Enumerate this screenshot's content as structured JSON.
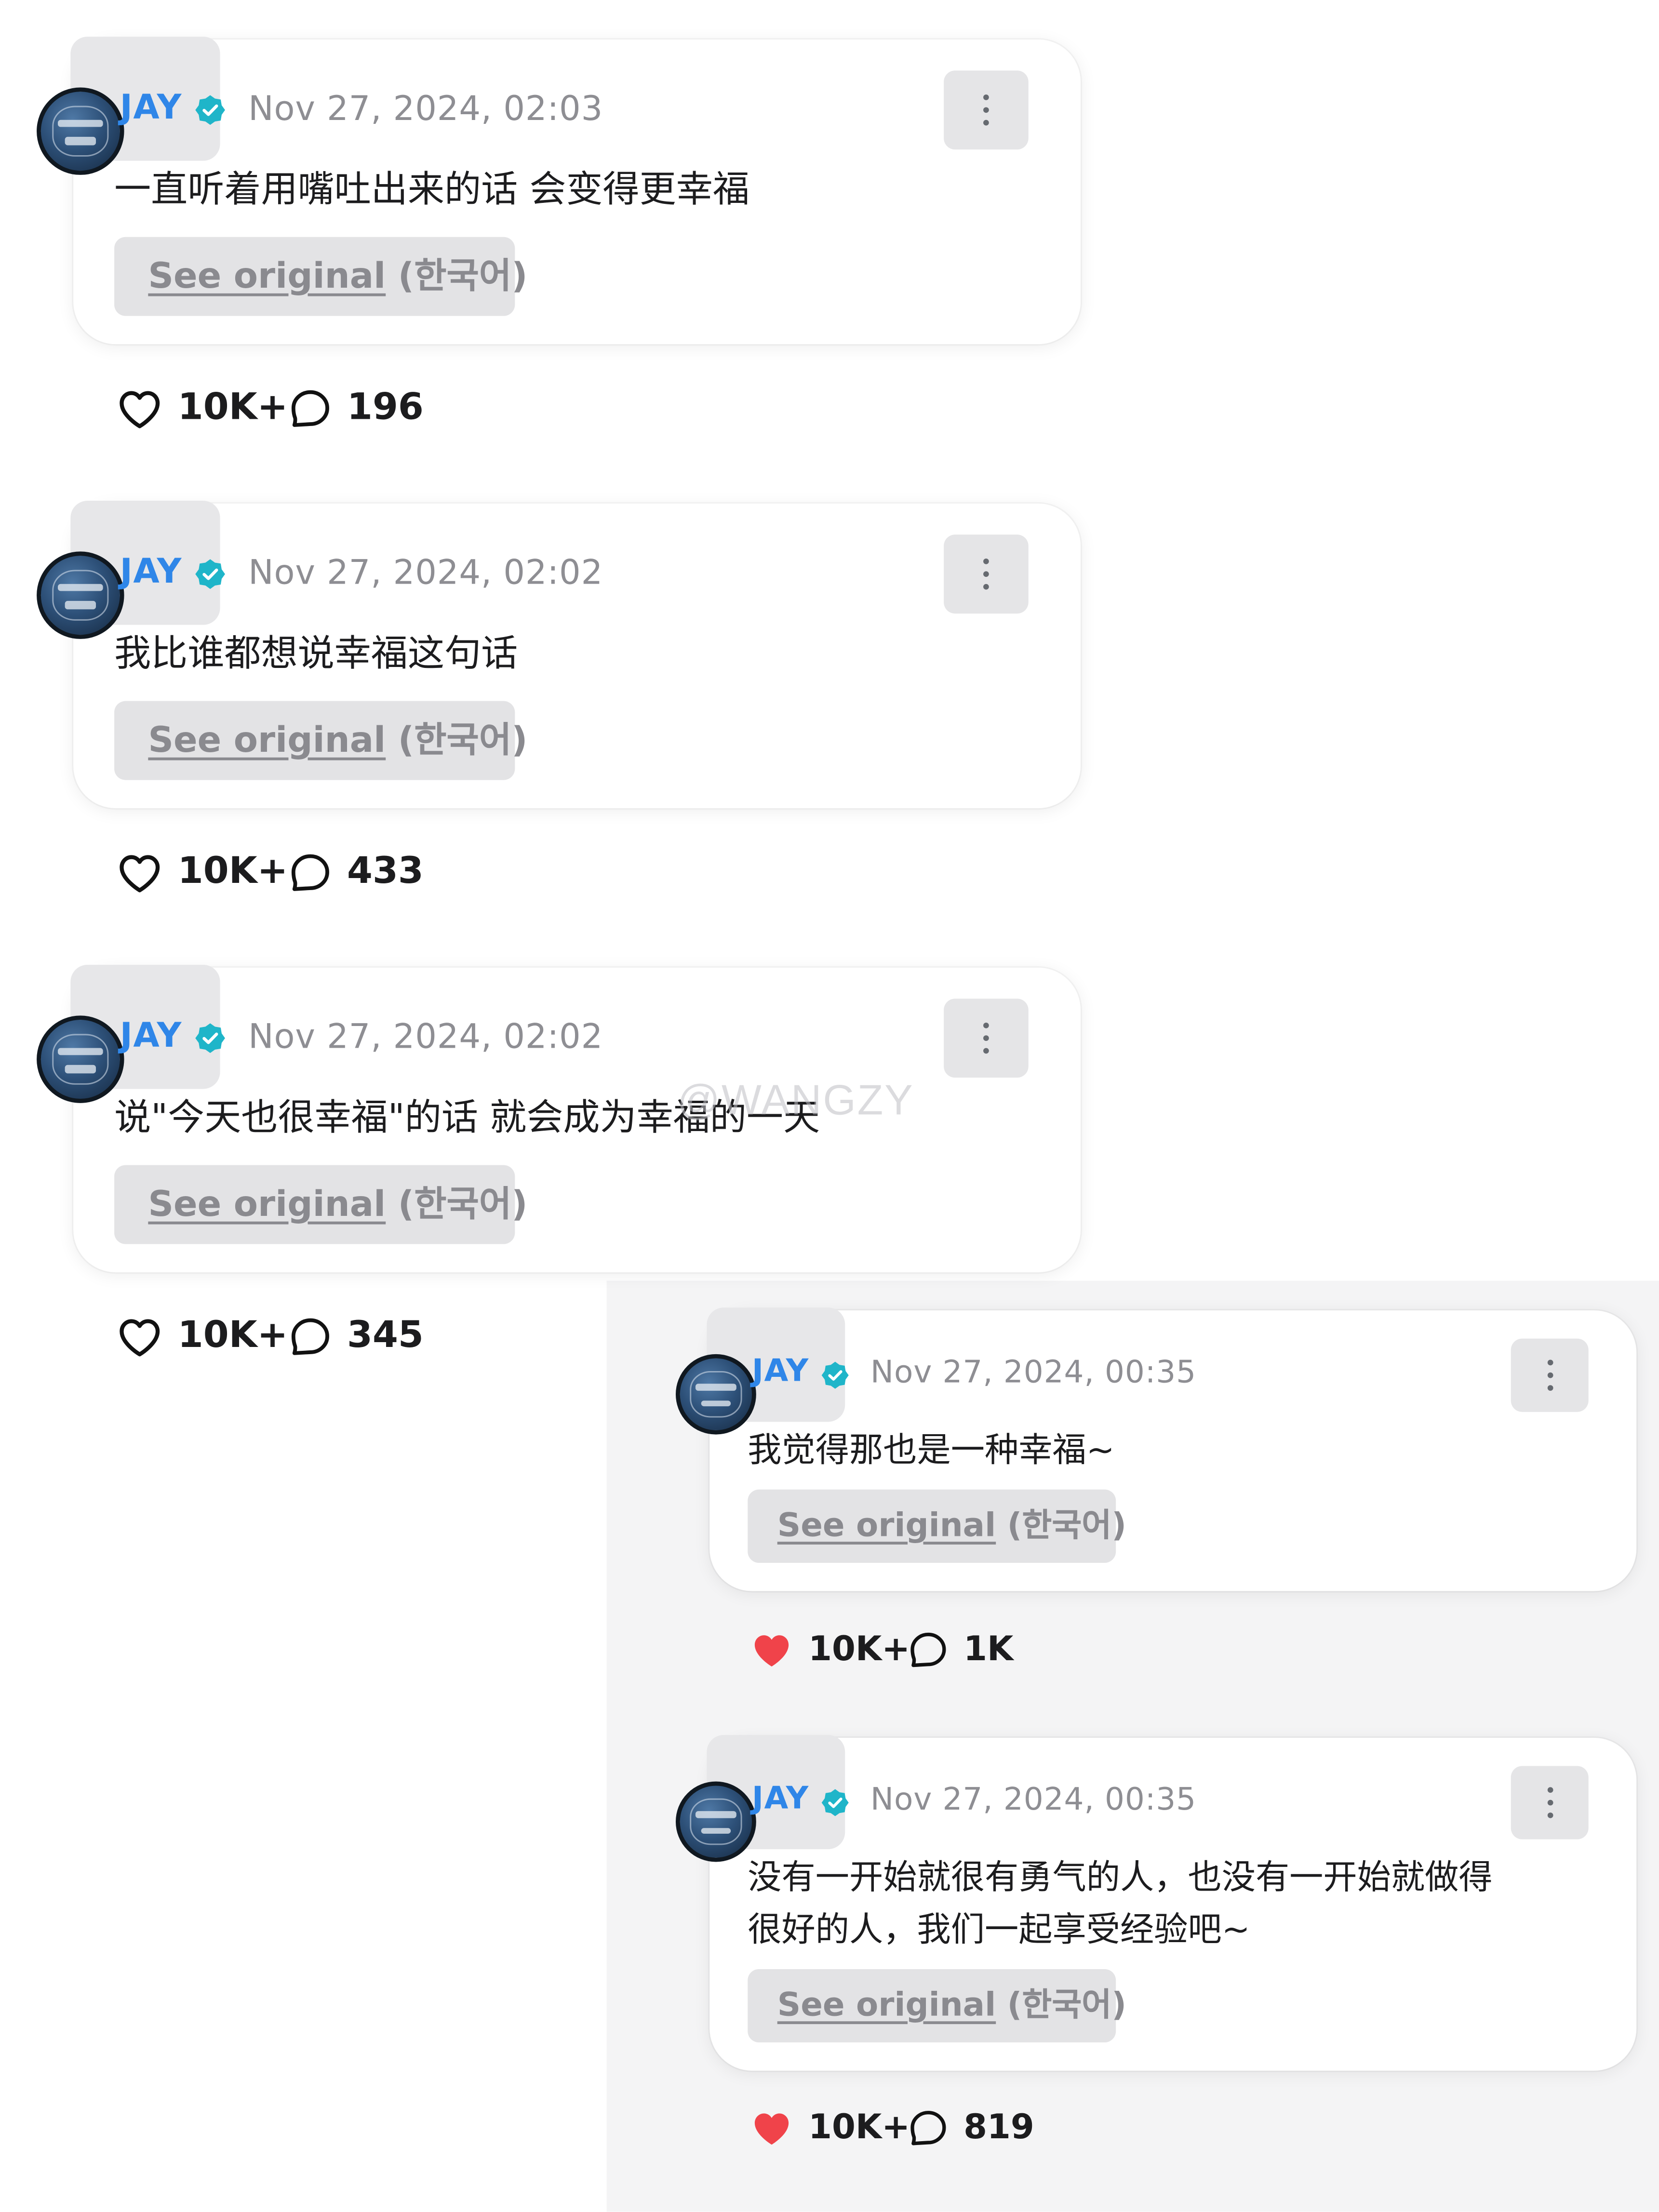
{
  "watermark": "@WANGZY",
  "posts": [
    {
      "author": "JAY",
      "timestamp": "Nov 27, 2024, 02:03",
      "message": "一直听着用嘴吐出来的话 会变得更幸福",
      "see_original_link": "See original",
      "see_original_lang": "(한국어)",
      "likes": "10K+",
      "comments": "196",
      "liked": false
    },
    {
      "author": "JAY",
      "timestamp": "Nov 27, 2024, 02:02",
      "message": "我比谁都想说幸福这句话",
      "see_original_link": "See original",
      "see_original_lang": "(한국어)",
      "likes": "10K+",
      "comments": "433",
      "liked": false
    },
    {
      "author": "JAY",
      "timestamp": "Nov 27, 2024, 02:02",
      "message": "说\"今天也很幸福\"的话 就会成为幸福的一天",
      "see_original_link": "See original",
      "see_original_lang": "(한국어)",
      "likes": "10K+",
      "comments": "345",
      "liked": false
    },
    {
      "author": "JAY",
      "timestamp": "Nov 27, 2024, 00:35",
      "message": "我觉得那也是一种幸福~",
      "see_original_link": "See original",
      "see_original_lang": "(한국어)",
      "likes": "10K+",
      "comments": "1K",
      "liked": true
    },
    {
      "author": "JAY",
      "timestamp": "Nov 27, 2024, 00:35",
      "message": "没有一开始就很有勇气的人，也没有一开始就做得\n很好的人，我们一起享受经验吧~",
      "see_original_link": "See original",
      "see_original_lang": "(한국어)",
      "likes": "10K+",
      "comments": "819",
      "liked": true
    }
  ],
  "colors": {
    "author": "#2f86e8",
    "verified": "#1fb5c9",
    "heart_active": "#f0434a",
    "timestamp": "#8e8e93"
  },
  "icons": {
    "menu": "more-vertical-icon",
    "verified": "verified-badge-icon",
    "like": "heart-icon",
    "comment": "comment-bubble-icon"
  }
}
